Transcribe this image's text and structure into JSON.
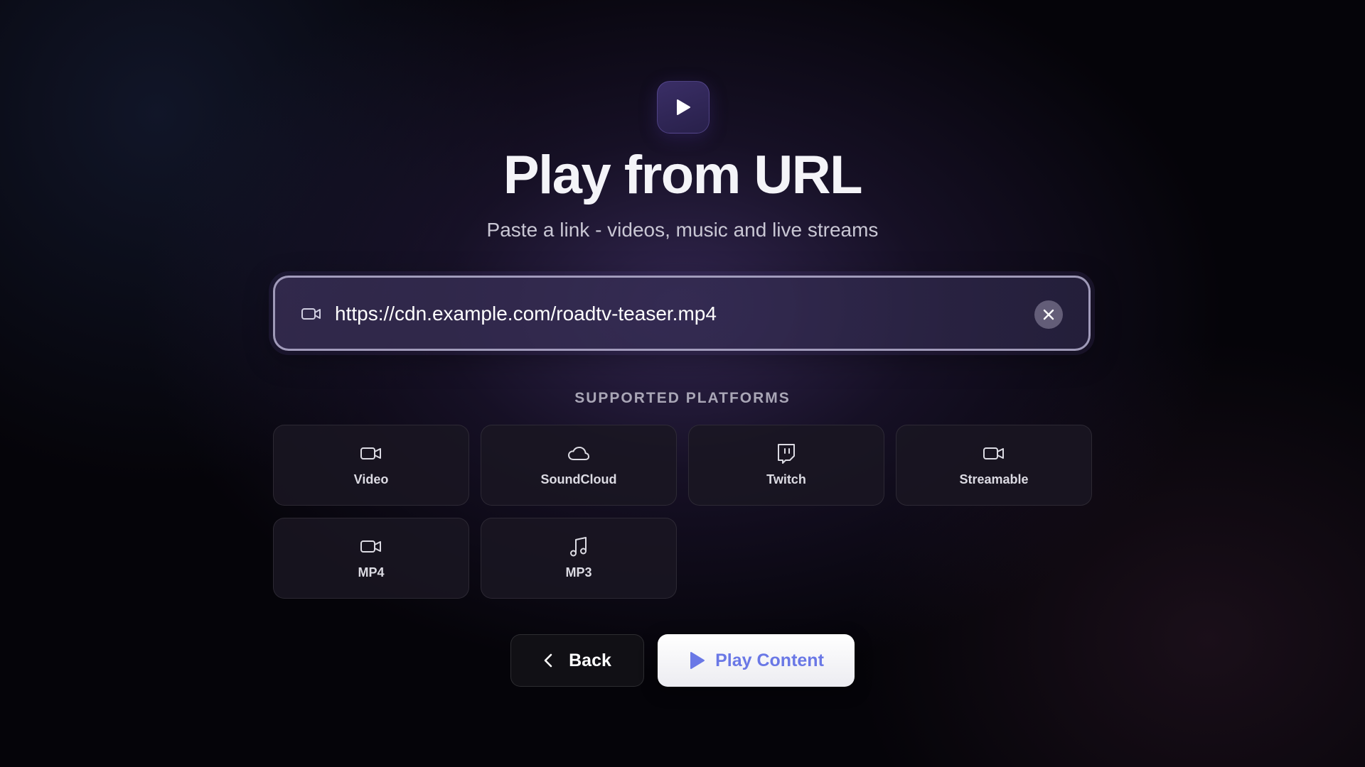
{
  "app": {
    "icon": "play-icon"
  },
  "header": {
    "title": "Play from URL",
    "subtitle": "Paste a link - videos, music and live streams"
  },
  "url_input": {
    "icon": "video-camera-icon",
    "value": "https://cdn.example.com/roadtv-teaser.mp4",
    "clear_icon": "close-icon"
  },
  "platforms": {
    "heading": "SUPPORTED PLATFORMS",
    "items": [
      {
        "label": "Video",
        "icon": "video-camera-icon"
      },
      {
        "label": "SoundCloud",
        "icon": "cloud-icon"
      },
      {
        "label": "Twitch",
        "icon": "twitch-icon"
      },
      {
        "label": "Streamable",
        "icon": "video-camera-icon"
      },
      {
        "label": "MP4",
        "icon": "video-camera-icon"
      },
      {
        "label": "MP3",
        "icon": "music-note-icon"
      }
    ]
  },
  "actions": {
    "back_label": "Back",
    "back_icon": "chevron-left-icon",
    "play_label": "Play Content",
    "play_icon": "play-icon"
  },
  "colors": {
    "accent": "#6a78e6",
    "logo_bg": "#2f2656",
    "background": "#050409"
  }
}
